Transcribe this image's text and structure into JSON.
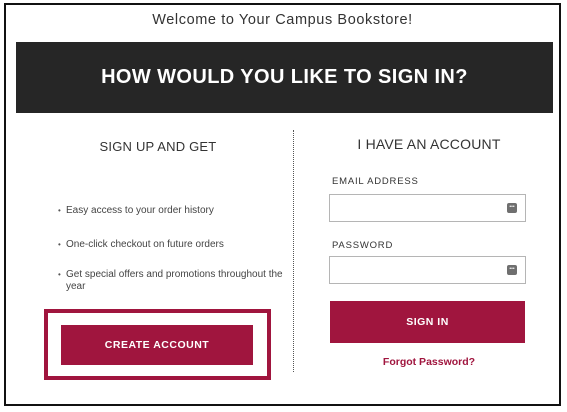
{
  "header": {
    "welcome": "Welcome to Your Campus Bookstore!",
    "banner_title": "HOW WOULD YOU LIKE TO SIGN IN?"
  },
  "signup": {
    "heading": "SIGN UP AND GET",
    "benefits": [
      "Easy access to your order history",
      "One-click checkout on future orders",
      "Get special offers and promotions throughout the year"
    ],
    "create_account_label": "CREATE ACCOUNT"
  },
  "signin": {
    "heading": "I HAVE AN ACCOUNT",
    "email_label": "EMAIL ADDRESS",
    "email_value": "",
    "password_label": "PASSWORD",
    "password_value": "",
    "sign_in_label": "SIGN IN",
    "forgot_label": "Forgot Password?"
  },
  "icons": {
    "email_field_icon": "password-manager-key-icon",
    "password_field_icon": "password-manager-key-icon"
  },
  "colors": {
    "brand": "#a0153e",
    "banner": "#262626"
  }
}
